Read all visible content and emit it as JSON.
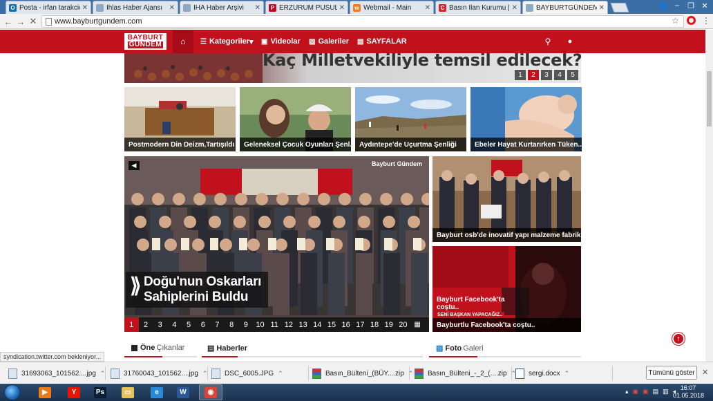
{
  "tabs": [
    {
      "title": "Posta - irfan tarakcioglu",
      "favicon": "outlook-icon",
      "color": "#0f6cbd",
      "glyph": "O"
    },
    {
      "title": "İhlas Haber Ajansı",
      "favicon": "doc-icon",
      "color": "#8da9c4",
      "glyph": ""
    },
    {
      "title": "IHA Haber Arşivi",
      "favicon": "doc-icon",
      "color": "#8da9c4",
      "glyph": ""
    },
    {
      "title": "ERZURUM PUSULA GAZE",
      "favicon": "pinterest-icon",
      "color": "#bd081c",
      "glyph": "P"
    },
    {
      "title": "Webmail - Main",
      "favicon": "webmail-icon",
      "color": "#f07c1e",
      "glyph": "w"
    },
    {
      "title": "Basın İlan Kurumu | Basın",
      "favicon": "bik-icon",
      "color": "#d8232a",
      "glyph": "C"
    },
    {
      "title": "BAYBURTGÜNDEM GAZE",
      "favicon": "doc-icon",
      "color": "#8da9c4",
      "glyph": ""
    }
  ],
  "address": {
    "url": "www.bayburtgundem.com"
  },
  "site": {
    "logo_top": "BAYBURT",
    "logo_bottom": "GÜNDEM",
    "nav": [
      {
        "label": "Kategoriler",
        "icon": "list-icon",
        "glyph": "☰",
        "caret": "▾"
      },
      {
        "label": "Videolar",
        "icon": "film-icon",
        "glyph": "▣",
        "caret": ""
      },
      {
        "label": "Galeriler",
        "icon": "image-icon",
        "glyph": "▨",
        "caret": ""
      },
      {
        "label": "SAYFALAR",
        "icon": "briefcase-icon",
        "glyph": "▤",
        "caret": ""
      }
    ],
    "banner_text": "Kaç Milletvekiliyle temsil edilecek?",
    "banner_pages": [
      "1",
      "2",
      "3",
      "4",
      "5"
    ],
    "banner_active": 1,
    "cards": [
      "Postmodern Din Deizm,Tartışıldı",
      "Geleneksel Çocuk Oyunları Şenl...",
      "Aydıntepe'de Uçurtma Şenliği",
      "Ebeler Hayat Kurtarırken Tüken..."
    ],
    "slider": {
      "title_line1": "Doğu'nun Oskarları",
      "title_line2": "Sahiplerini Buldu",
      "watermark": "Bayburt Gündem",
      "pages": [
        "1",
        "2",
        "3",
        "4",
        "5",
        "6",
        "7",
        "8",
        "9",
        "10",
        "11",
        "12",
        "13",
        "14",
        "15",
        "16",
        "17",
        "18",
        "19",
        "20"
      ],
      "active": 0
    },
    "side_cards": [
      "Bayburt osb'de inovatif yapı malzeme fabrik...",
      "Bayburtlu Facebook'ta coştu.."
    ],
    "side_overlay": {
      "line1": "Bayburt Facebook'ta",
      "line2": "coştu..",
      "strip": "SENİ BAŞKAN YAPACAĞIZ.."
    },
    "sections": [
      {
        "bold": "Öne",
        "light": "Çıkanlar"
      },
      {
        "bold": "Haberler",
        "light": ""
      },
      {
        "bold": "Foto",
        "light": "Galeri"
      }
    ]
  },
  "status_text": "syndication.twitter.com bekleniyor...",
  "downloads": [
    {
      "name": "31693063_101562....jpg",
      "type": "image"
    },
    {
      "name": "31760043_101562....jpg",
      "type": "image"
    },
    {
      "name": "DSC_6005.JPG",
      "type": "image"
    },
    {
      "name": "Basın_Bülteni_(BÜY....zip",
      "type": "zip"
    },
    {
      "name": "Basın_Bülteni_-_2_(....zip",
      "type": "zip"
    },
    {
      "name": "sergi.docx",
      "type": "word"
    }
  ],
  "show_all": "Tümünü göster",
  "taskbar": {
    "apps": [
      {
        "name": "media-player-icon",
        "color": "#e87b17",
        "glyph": "▶"
      },
      {
        "name": "yandex-icon",
        "color": "#e61400",
        "glyph": "Y"
      },
      {
        "name": "photoshop-icon",
        "color": "#0a1d36",
        "glyph": "Ps"
      },
      {
        "name": "explorer-icon",
        "color": "#e8c25a",
        "glyph": "▭"
      },
      {
        "name": "internet-explorer-icon",
        "color": "#2a8ad8",
        "glyph": "e"
      },
      {
        "name": "word-icon",
        "color": "#2b5797",
        "glyph": "W"
      },
      {
        "name": "chrome-icon",
        "color": "#db4437",
        "glyph": "◉"
      }
    ],
    "time": "16:07",
    "date": "01.05.2018"
  }
}
